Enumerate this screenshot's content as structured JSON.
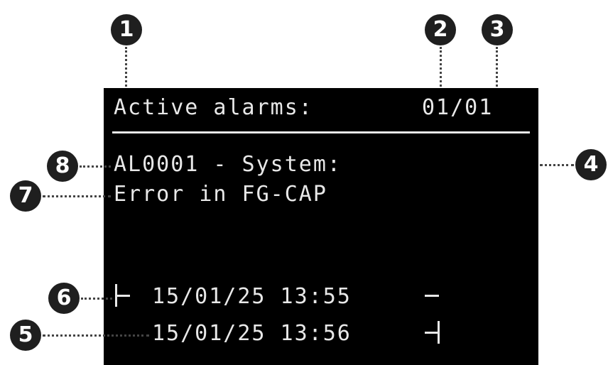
{
  "display": {
    "header_title": "Active alarms:",
    "alarm_index": "01/01",
    "alarm_code_line": "AL0001 - System:",
    "alarm_description": "Error in FG-CAP",
    "start_timestamp": "15/01/25 13:55",
    "end_timestamp": "15/01/25 13:56"
  },
  "callouts": [
    "1",
    "2",
    "3",
    "4",
    "5",
    "6",
    "7",
    "8"
  ],
  "colors": {
    "screen_bg": "#000000",
    "lcd_text": "#e8e8e8",
    "callout_bg": "#1f1f1f"
  }
}
